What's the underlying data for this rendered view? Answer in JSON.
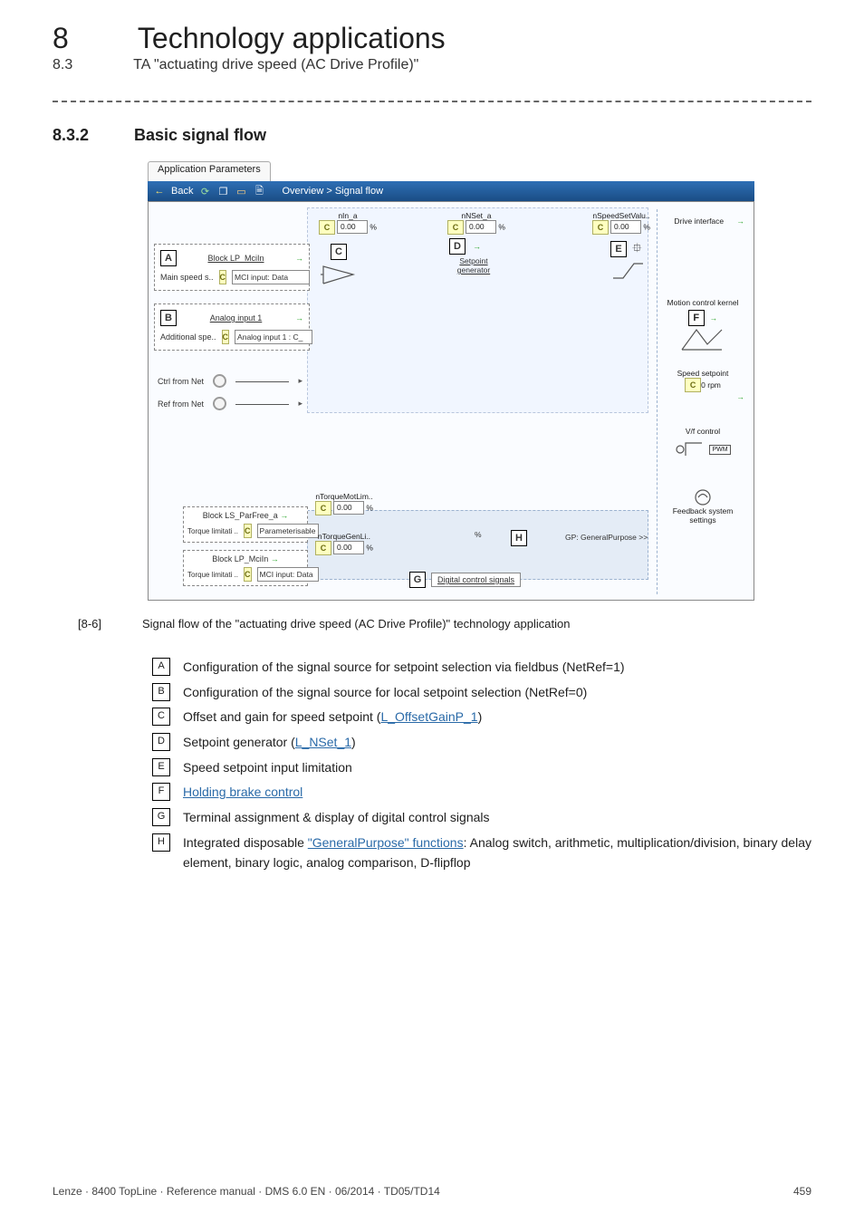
{
  "chapter": {
    "number": "8",
    "title": "Technology applications"
  },
  "subsection": {
    "number": "8.3",
    "title": "TA \"actuating drive speed (AC Drive Profile)\""
  },
  "heading": {
    "number": "8.3.2",
    "title": "Basic signal flow"
  },
  "figure": {
    "tab": "Application Parameters",
    "bar": {
      "back": "Back",
      "breadcrumb": "Overview > Signal flow"
    },
    "blocks": {
      "A": {
        "title": "Block LP_MciIn",
        "row_label": "Main speed s..",
        "row_value": "MCI input: Data"
      },
      "B": {
        "title": "Analog input 1",
        "row_label": "Additional spe..",
        "row_value": "Analog input 1 : C_"
      },
      "ctrl_from_net": "Ctrl from Net",
      "ref_from_net": "Ref from Net",
      "nIn_a": {
        "label": "nIn_a",
        "value": "0.00",
        "unit": "%"
      },
      "nNSet_a": {
        "label": "nNSet_a",
        "value": "0.00",
        "unit": "%"
      },
      "setpoint_gen": "Setpoint generator",
      "nSpeedSetValu": {
        "label": "nSpeedSetValu..",
        "value": "0.00",
        "unit": "%"
      },
      "drive_interface": "Drive interface",
      "motion_kernel": "Motion control kernel",
      "speed_setpoint": {
        "label": "Speed setpoint",
        "value": "0",
        "unit": "rpm"
      },
      "vf_control": "V/f control",
      "pwm": "PWM",
      "feedback": "Feedback system settings",
      "torque_block": {
        "ls_parfree": "Block LS_ParFree_a",
        "ls_parfree_row_label": "Torque limitati ..",
        "ls_parfree_row_value": "Parameterisable",
        "lp_mciin": "Block LP_MciIn",
        "lp_mciin_row_label": "Torque limitati ..",
        "lp_mciin_row_value": "MCI input: Data"
      },
      "nTorqueMotLim": {
        "label": "nTorqueMotLim..",
        "value": "0.00",
        "unit": "%"
      },
      "nTorqueGenLi": {
        "label": "nTorqueGenLi..",
        "value": "0.00",
        "unit": "%"
      },
      "mid_pct": "%",
      "gp": "GP: GeneralPurpose >>",
      "digital_signals": "Digital control signals"
    }
  },
  "caption": {
    "id": "[8-6]",
    "text": "Signal flow of the \"actuating drive speed (AC Drive Profile)\" technology application"
  },
  "legend": {
    "A": "Configuration of the signal source for setpoint selection via fieldbus (NetRef=1)",
    "B": "Configuration of the signal source for local setpoint selection (NetRef=0)",
    "C_pre": "Offset and gain for speed setpoint (",
    "C_link": "L_OffsetGainP_1",
    "C_post": ")",
    "D_pre": "Setpoint generator (",
    "D_link": "L_NSet_1",
    "D_post": ")",
    "E": "Speed setpoint input limitation",
    "F": "Holding brake control",
    "G": "Terminal assignment & display of digital control signals",
    "H_pre": "Integrated disposable ",
    "H_link": "\"GeneralPurpose\" functions",
    "H_post": ": Analog switch, arithmetic, multiplication/division, binary delay element, binary logic, analog comparison, D-flipflop"
  },
  "footer": {
    "left": "Lenze · 8400 TopLine · Reference manual · DMS 6.0 EN · 06/2014 · TD05/TD14",
    "right": "459"
  }
}
